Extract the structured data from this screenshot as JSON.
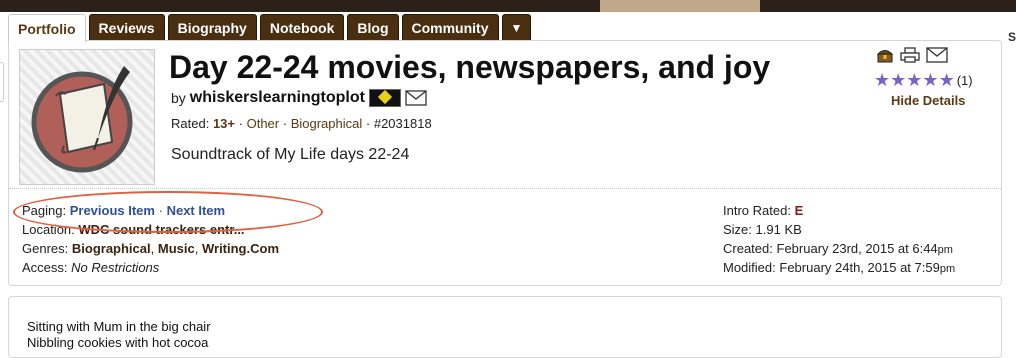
{
  "tabs": [
    {
      "label": "Portfolio",
      "active": true
    },
    {
      "label": "Reviews"
    },
    {
      "label": "Biography"
    },
    {
      "label": "Notebook"
    },
    {
      "label": "Blog"
    },
    {
      "label": "Community"
    },
    {
      "label": "▼"
    }
  ],
  "right_edge_text": "S",
  "item": {
    "title": "Day 22-24 movies, newspapers, and joy",
    "by": "by",
    "author": "whiskerslearningtoplot",
    "rated_label": "Rated:",
    "rating": "13+",
    "sep": "·",
    "genre1": "Other",
    "genre2": "Biographical",
    "item_id": "#2031818",
    "tagline": "Soundtrack of My Life days 22-24",
    "stars": 5,
    "review_count": "(1)",
    "hide_details": "Hide Details"
  },
  "icons": {
    "treasure": "treasure-chest-icon",
    "print": "printer-icon",
    "mail": "envelope-icon",
    "author_mail": "envelope-icon",
    "author_badge": "member-badge-icon",
    "thumbnail": "quill-and-scroll-icon",
    "star": "star-icon"
  },
  "colors": {
    "tab_bg": "#4a2e10",
    "link_blue": "#2f4f9a",
    "link_brown": "#5a3a12",
    "star_purple": "#7a63c6",
    "highlight_oval": "#e06040",
    "rating_red": "#8b1a1a"
  },
  "details": {
    "paging_label": "Paging:",
    "previous_item": "Previous Item",
    "dot": "·",
    "next_item": "Next Item",
    "location_label": "Location:",
    "location_value": "WDC sound trackers entr...",
    "genres_label": "Genres:",
    "genres": [
      "Biographical",
      "Music",
      "Writing.Com"
    ],
    "genres_sep": ",",
    "access_label": "Access:",
    "access_value": "No Restrictions",
    "intro_rated_label": "Intro Rated:",
    "intro_rated_value": "E",
    "size_label": "Size:",
    "size_value": "1.91 KB",
    "created_label": "Created:",
    "created_value": "February 23rd, 2015 at 6:44",
    "created_ampm": "pm",
    "modified_label": "Modified:",
    "modified_value": "February 24th, 2015 at 7:59",
    "modified_ampm": "pm"
  },
  "content": {
    "lines": [
      "Sitting with Mum in the big chair",
      "Nibbling cookies with hot cocoa"
    ]
  }
}
